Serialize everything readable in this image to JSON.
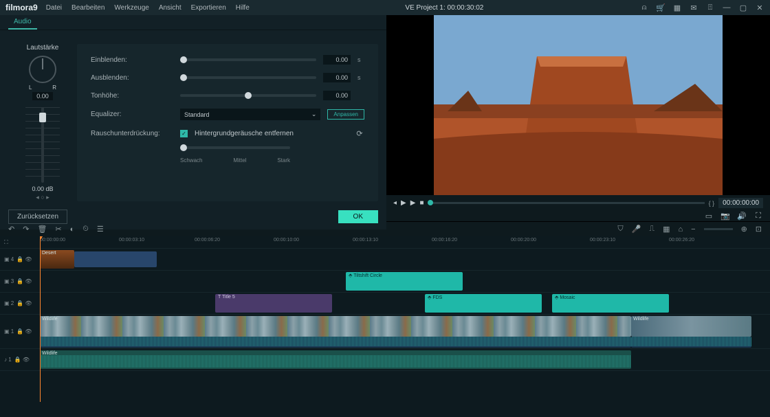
{
  "app": {
    "logo": "filmora9",
    "title": "VE Project 1: 00:00:30:02"
  },
  "menu": [
    "Datei",
    "Bearbeiten",
    "Werkzeuge",
    "Ansicht",
    "Exportieren",
    "Hilfe"
  ],
  "tabs": {
    "audio": "Audio"
  },
  "volume": {
    "label": "Lautstärke",
    "l": "L",
    "r": "R",
    "dial_val": "0.00",
    "slider_val": "0.00",
    "db": "dB"
  },
  "params": {
    "fadein": {
      "label": "Einblenden:",
      "value": "0.00",
      "unit": "s"
    },
    "fadeout": {
      "label": "Ausblenden:",
      "value": "0.00",
      "unit": "s"
    },
    "pitch": {
      "label": "Tonhöhe:",
      "value": "0.00"
    },
    "equalizer": {
      "label": "Equalizer:",
      "value": "Standard",
      "adjust": "Anpassen"
    },
    "denoise": {
      "label": "Rauschunterdrückung:",
      "check_label": "Hintergrundgeräusche entfernen",
      "weak": "Schwach",
      "mid": "Mittel",
      "strong": "Stark"
    }
  },
  "buttons": {
    "reset": "Zurücksetzen",
    "ok": "OK"
  },
  "player": {
    "time": "00:00:00:00",
    "frame_nav": "{  }"
  },
  "ruler": [
    "00:00:00:00",
    "00:00:03:10",
    "00:00:06:20",
    "00:00:10:00",
    "00:00:13:10",
    "00:00:16:20",
    "00:00:20:00",
    "00:00:23:10",
    "00:00:26:20"
  ],
  "tracks": {
    "t4": "▣ 4",
    "t3": "▣ 3",
    "t2": "▣ 2",
    "t1": "▣ 1",
    "a1": "♪ 1"
  },
  "clips": {
    "desert": "Desert",
    "tiltshift": "Tiltshift Circle",
    "title5": "Title 5",
    "fds": "FDS",
    "mosaic": "Mosaic",
    "wildlife": "Wildlife"
  }
}
